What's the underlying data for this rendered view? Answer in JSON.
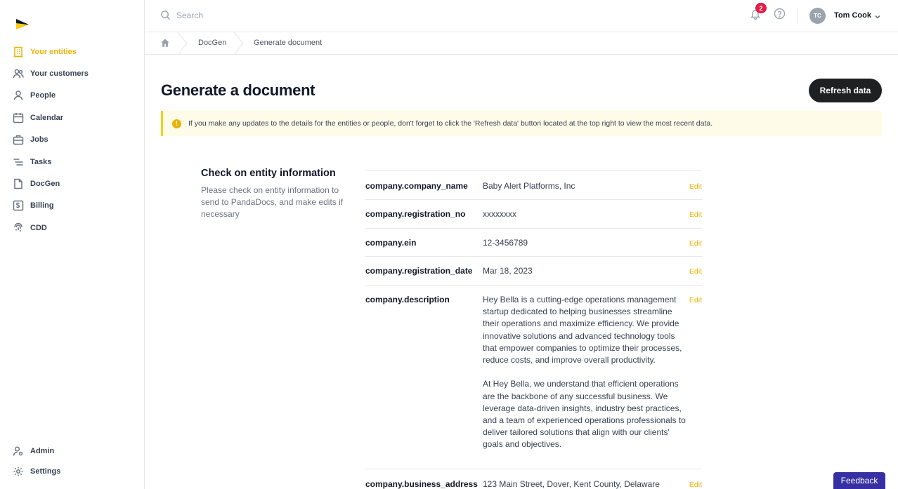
{
  "sidebar": {
    "items": [
      {
        "label": "Your entities",
        "icon": "building-icon",
        "active": true
      },
      {
        "label": "Your customers",
        "icon": "users-icon"
      },
      {
        "label": "People",
        "icon": "user-icon"
      },
      {
        "label": "Calendar",
        "icon": "calendar-icon"
      },
      {
        "label": "Jobs",
        "icon": "briefcase-icon"
      },
      {
        "label": "Tasks",
        "icon": "list-icon"
      },
      {
        "label": "DocGen",
        "icon": "document-icon"
      },
      {
        "label": "Billing",
        "icon": "billing-icon"
      },
      {
        "label": "CDD",
        "icon": "fingerprint-icon"
      }
    ],
    "bottom": [
      {
        "label": "Admin",
        "icon": "admin-user-icon"
      },
      {
        "label": "Settings",
        "icon": "gear-icon"
      }
    ]
  },
  "topbar": {
    "search_placeholder": "Search",
    "notification_count": "2",
    "user_initials": "TC",
    "user_name": "Tom Cook"
  },
  "breadcrumb": {
    "items": [
      "DocGen",
      "Generate document"
    ]
  },
  "main": {
    "title": "Generate a document",
    "refresh_label": "Refresh data",
    "alert_icon": "!",
    "alert_text": "If you make any updates to the details for the entities or people, don't forget to click the 'Refresh data' button located at the top right to view the most recent data.",
    "section_title": "Check on entity information",
    "section_desc": "Please check on entity information to send to PandaDocs, and make edits if necessary",
    "edit_label": "Edit",
    "fields": [
      {
        "key": "company.company_name",
        "value": "Baby Alert Platforms, Inc"
      },
      {
        "key": "company.registration_no",
        "value": "xxxxxxxx"
      },
      {
        "key": "company.ein",
        "value": "12-3456789"
      },
      {
        "key": "company.registration_date",
        "value": "Mar 18, 2023"
      },
      {
        "key": "company.description",
        "value": "Hey Bella is a cutting-edge operations management startup dedicated to helping businesses streamline their operations and maximize efficiency. We provide innovative solutions and advanced technology tools that empower companies to optimize their processes, reduce costs, and improve overall productivity.\n\nAt Hey Bella, we understand that efficient operations are the backbone of any successful business. We leverage data-driven insights, industry best practices, and a team of experienced operations professionals to deliver tailored solutions that align with our clients' goals and objectives."
      },
      {
        "key": "company.business_address",
        "value": "123 Main Street, Dover, Kent County, Delaware"
      }
    ]
  },
  "feedback_label": "Feedback",
  "colors": {
    "accent": "#eab308",
    "dark_button": "#1f2022",
    "feedback": "#3730a3",
    "badge": "#e11d48"
  }
}
